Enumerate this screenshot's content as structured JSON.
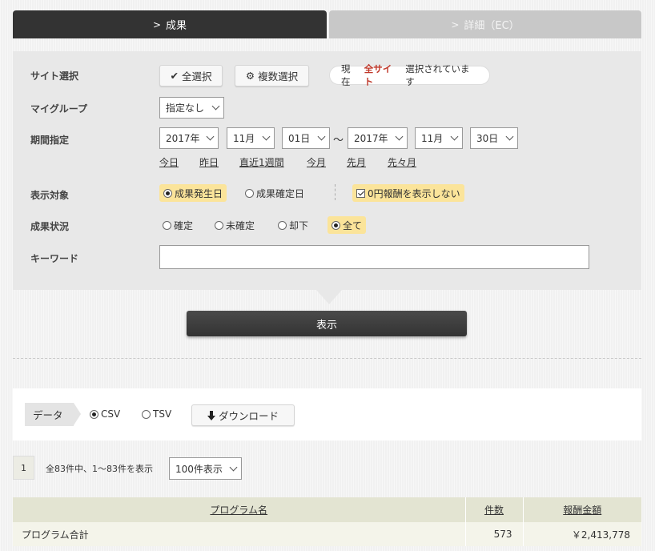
{
  "tabs": {
    "active": "成果",
    "inactive": "詳細（EC）"
  },
  "filters": {
    "site": {
      "label": "サイト選択",
      "select_all": "全選択",
      "multi_select": "複数選択",
      "status_prefix": "現在",
      "status_value": "全サイト",
      "status_suffix": "選択されています"
    },
    "mygroup": {
      "label": "マイグループ",
      "value": "指定なし"
    },
    "period": {
      "label": "期間指定",
      "from_year": "2017年",
      "from_month": "11月",
      "from_day": "01日",
      "separator": "～",
      "to_year": "2017年",
      "to_month": "11月",
      "to_day": "30日",
      "shortcuts": [
        "今日",
        "昨日",
        "直近1週間",
        "今月",
        "先月",
        "先々月"
      ]
    },
    "target": {
      "label": "表示対象",
      "option1": "成果発生日",
      "option2": "成果確定日",
      "checkbox": "0円報酬を表示しない"
    },
    "status": {
      "label": "成果状況",
      "options": [
        "確定",
        "未確定",
        "却下",
        "全て"
      ]
    },
    "keyword": {
      "label": "キーワード",
      "value": ""
    },
    "show_button": "表示"
  },
  "download": {
    "tag": "データ",
    "csv": "CSV",
    "tsv": "TSV",
    "button": "ダウンロード"
  },
  "pagination": {
    "page": "1",
    "info": "全83件中、1～83件を表示",
    "per_page": "100件表示"
  },
  "table": {
    "headers": [
      "プログラム名",
      "件数",
      "報酬金額"
    ],
    "rows": [
      {
        "name": "プログラム合計",
        "count": "573",
        "amount": "￥2,413,778"
      }
    ]
  },
  "colors": {
    "tab_active": "#333333",
    "tab_inactive": "#c8c8c8",
    "highlight": "#fbe49a",
    "site_status": "#c0392b",
    "table_header": "#e3e4d2"
  }
}
